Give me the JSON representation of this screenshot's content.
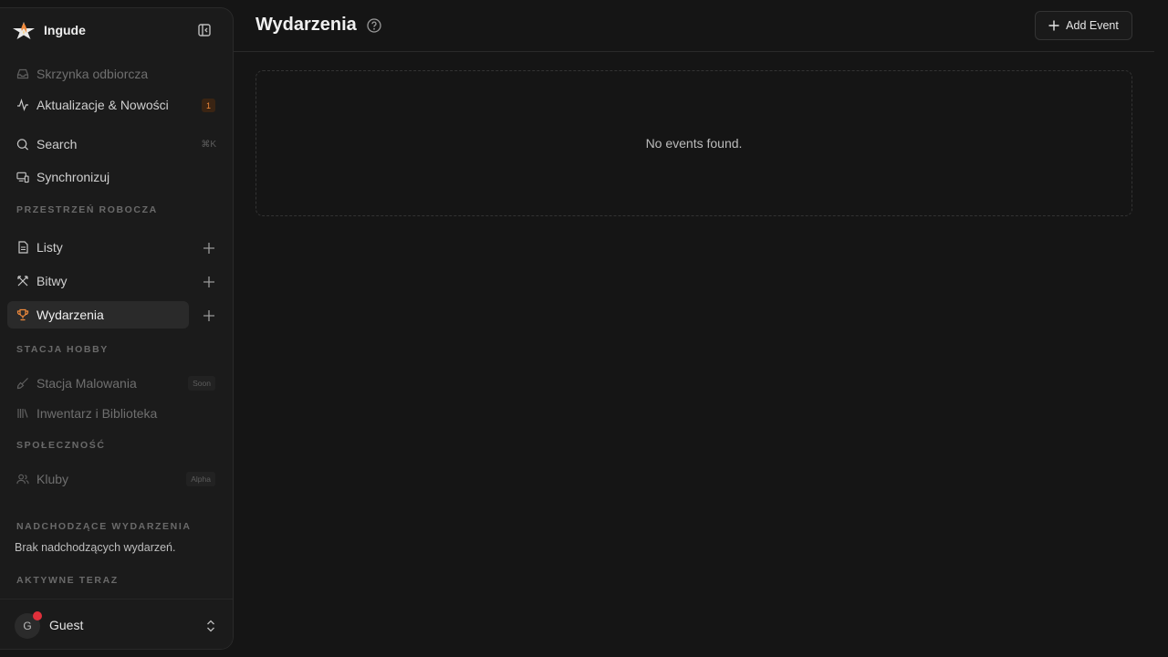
{
  "brand": {
    "name": "Ingude",
    "logo_icon": "flame-star-logo",
    "accent": "#f08a3c"
  },
  "sidebar": {
    "top_items": [
      {
        "label": "Skrzynka odbiorcza",
        "icon": "inbox-icon",
        "disabled": true
      },
      {
        "label": "Aktualizacje & Nowości",
        "icon": "activity-icon",
        "badge": "1"
      },
      {
        "label": "Search",
        "icon": "search-icon",
        "shortcut": "⌘K"
      },
      {
        "label": "Synchronizuj",
        "icon": "devices-icon"
      }
    ],
    "sections": [
      {
        "title": "PRZESTRZEŃ ROBOCZA",
        "items": [
          {
            "label": "Listy",
            "icon": "file-icon"
          },
          {
            "label": "Bitwy",
            "icon": "swords-icon"
          },
          {
            "label": "Wydarzenia",
            "icon": "trophy-icon",
            "active": true
          }
        ]
      },
      {
        "title": "STACJA HOBBY",
        "items": [
          {
            "label": "Stacja Malowania",
            "icon": "brush-icon",
            "tag": "Soon",
            "disabled": true
          },
          {
            "label": "Inwentarz i Biblioteka",
            "icon": "library-icon",
            "disabled": true
          }
        ]
      },
      {
        "title": "SPOŁECZNOŚĆ",
        "items": [
          {
            "label": "Kluby",
            "icon": "users-icon",
            "tag": "Alpha",
            "disabled": true
          }
        ]
      }
    ],
    "upcoming": {
      "title": "NADCHODZĄCE WYDARZENIA",
      "empty_text": "Brak nadchodzących wydarzeń."
    },
    "active_now": {
      "title": "AKTYWNE TERAZ"
    }
  },
  "user": {
    "initial": "G",
    "name": "Guest",
    "status_color": "#e0303b"
  },
  "main": {
    "title": "Wydarzenia",
    "add_button_label": "Add Event",
    "empty_text": "No events found."
  }
}
